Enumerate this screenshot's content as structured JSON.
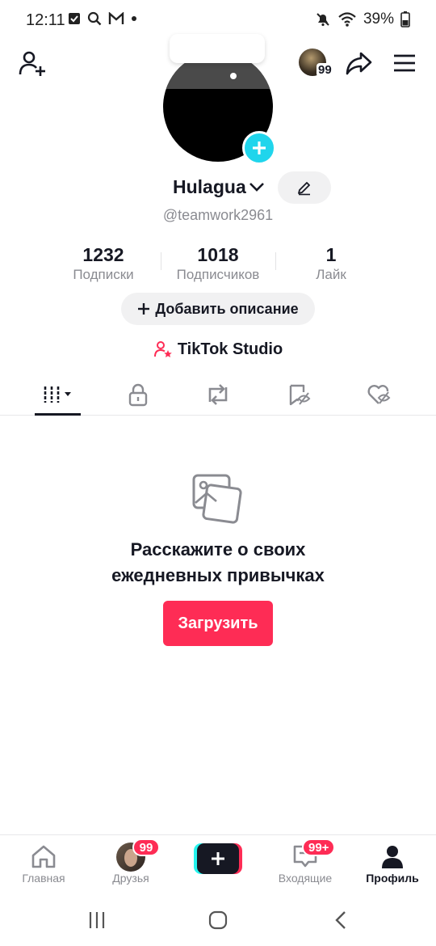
{
  "status_bar": {
    "time": "12:11",
    "battery": "39%"
  },
  "top_nav": {
    "avatar_badge": "99"
  },
  "profile": {
    "username": "Hulagua",
    "handle": "@teamwork2961"
  },
  "stats": [
    {
      "value": "1232",
      "label": "Подписки"
    },
    {
      "value": "1018",
      "label": "Подписчиков"
    },
    {
      "value": "1",
      "label": "Лайк"
    }
  ],
  "add_bio_label": "Добавить описание",
  "studio_label": "TikTok Studio",
  "empty_state": {
    "title_line1": "Расскажите о своих",
    "title_line2": "ежедневных привычках",
    "upload_label": "Загрузить"
  },
  "bottom_nav": {
    "home_label": "Главная",
    "friends_label": "Друзья",
    "friends_badge": "99",
    "inbox_label": "Входящие",
    "inbox_badge": "99+",
    "profile_label": "Профиль"
  },
  "colors": {
    "accent": "#fe2c55",
    "cyan": "#20d5ec",
    "text": "#161823",
    "muted": "#8a8b91"
  }
}
